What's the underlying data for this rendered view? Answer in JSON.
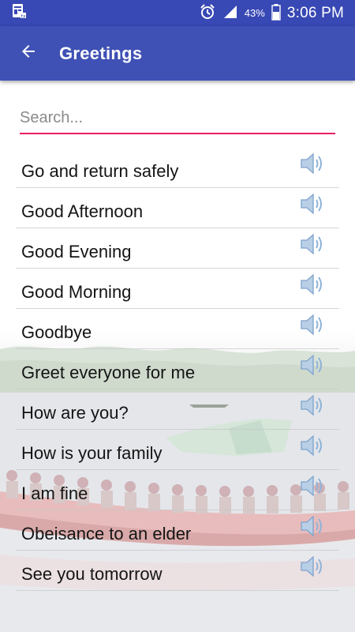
{
  "status_bar": {
    "battery_percent": "43%",
    "time": "3:06 PM",
    "icons": [
      "app-notification-icon",
      "alarm-icon",
      "signal-icon",
      "battery-icon"
    ]
  },
  "app_bar": {
    "title": "Greetings",
    "back_icon": "arrow-back-icon"
  },
  "search": {
    "placeholder": "Search...",
    "value": ""
  },
  "phrases": [
    {
      "label": "Go and return safely",
      "icon": "speaker-icon"
    },
    {
      "label": "Good Afternoon",
      "icon": "speaker-icon"
    },
    {
      "label": "Good Evening",
      "icon": "speaker-icon"
    },
    {
      "label": "Good Morning",
      "icon": "speaker-icon"
    },
    {
      "label": "Goodbye",
      "icon": "speaker-icon"
    },
    {
      "label": "Greet everyone for me",
      "icon": "speaker-icon"
    },
    {
      "label": "How are you?",
      "icon": "speaker-icon"
    },
    {
      "label": "How is your family",
      "icon": "speaker-icon"
    },
    {
      "label": "I am fine",
      "icon": "speaker-icon"
    },
    {
      "label": "Obeisance to an elder",
      "icon": "speaker-icon"
    },
    {
      "label": "See you tomorrow",
      "icon": "speaker-icon"
    }
  ],
  "colors": {
    "status_bar": "#3848b4",
    "app_bar": "#3f51b5",
    "search_underline": "#e91e63",
    "speaker_icon": "#8fb3d9"
  }
}
